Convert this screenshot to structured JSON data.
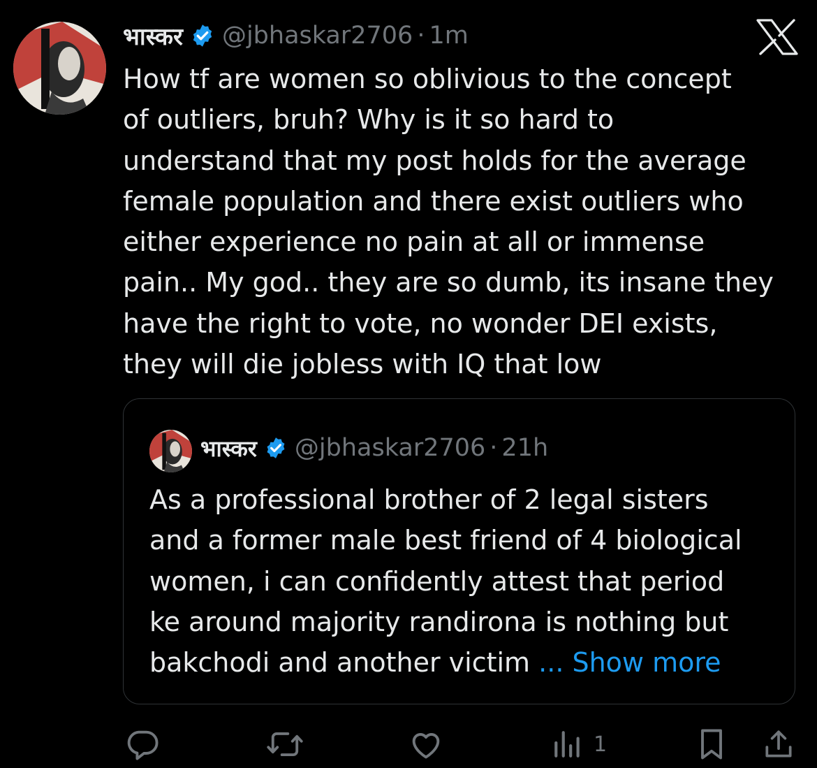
{
  "tweet": {
    "display_name": "भास्कर",
    "handle": "@jbhaskar2706",
    "separator": "·",
    "time": "1m",
    "text": "How tf are women so oblivious to the concept\nof outliers, bruh? Why is it so hard to\nunderstand that my post holds for the average\nfemale population and there exist outliers who\neither experience no pain at all or immense\npain.. My god.. they are so dumb, its insane they\nhave the right to vote, no wonder DEI exists,\nthey will die jobless with IQ that low"
  },
  "quoted": {
    "display_name": "भास्कर",
    "handle": "@jbhaskar2706",
    "separator": "·",
    "time": "21h",
    "text": "As a professional brother of 2 legal sisters\nand a former male best friend of 4 biological\nwomen, i can confidently attest that period\nke around majority randirona is nothing but\nbakchodi and another victim ",
    "ellipsis_more": "... Show more"
  },
  "actions": {
    "views_count": "1",
    "icons": [
      "reply-icon",
      "retweet-icon",
      "like-icon",
      "views-icon",
      "bookmark-icon",
      "share-icon"
    ]
  },
  "colors": {
    "background": "#000000",
    "text": "#e7e9ea",
    "secondary": "#71767b",
    "accent": "#1d9bf0",
    "border": "#2f3336"
  }
}
